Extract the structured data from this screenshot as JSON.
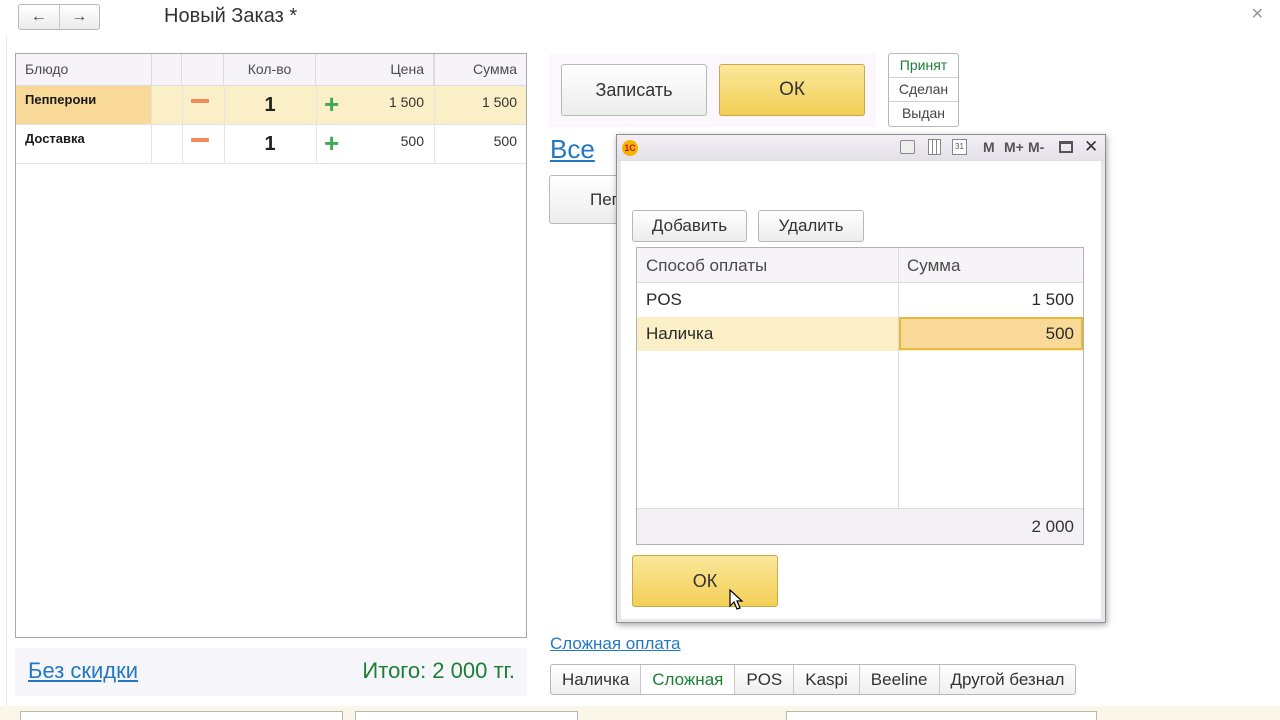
{
  "header": {
    "back_icon": "arrow-left-icon",
    "forward_icon": "arrow-right-icon",
    "title": "Новый Заказ *",
    "close_icon": "close-icon"
  },
  "order_table": {
    "columns": [
      "Блюдо",
      "Кол-во",
      "Цена",
      "Сумма"
    ],
    "rows": [
      {
        "dish": "Пепперони",
        "qty": "1",
        "price": "1 500",
        "sum": "1 500",
        "selected": true
      },
      {
        "dish": "Доставка",
        "qty": "1",
        "price": "500",
        "sum": "500",
        "selected": false
      }
    ]
  },
  "footer": {
    "discount_link": "Без скидки",
    "total": "Итого: 2 000 тг."
  },
  "actions": {
    "write_label": "Записать",
    "ok_label": "ОК"
  },
  "statuses": [
    {
      "label": "Принят",
      "active": true
    },
    {
      "label": "Сделан",
      "active": false
    },
    {
      "label": "Выдан",
      "active": false
    }
  ],
  "categories_link": "Все",
  "hidden_button_partial": "Пеп",
  "dialog": {
    "app_icon": "1c-logo-icon",
    "toolbar_icons": [
      "print-icon",
      "calculator-icon",
      "calendar-icon"
    ],
    "memory_buttons": [
      "M",
      "M+",
      "M-"
    ],
    "add_label": "Добавить",
    "delete_label": "Удалить",
    "columns": [
      "Способ оплаты",
      "Сумма"
    ],
    "rows": [
      {
        "method": "POS",
        "amount": "1 500"
      },
      {
        "method": "Наличка",
        "amount": "500"
      }
    ],
    "total": "2 000",
    "ok_label": "ОК"
  },
  "complex_payment_link": "Сложная оплата",
  "payment_tabs": [
    {
      "label": "Наличка",
      "active": false
    },
    {
      "label": "Сложная",
      "active": true
    },
    {
      "label": "POS",
      "active": false
    },
    {
      "label": "Kaspi",
      "active": false
    },
    {
      "label": "Beeline",
      "active": false
    },
    {
      "label": "Другой безнал",
      "active": false
    }
  ],
  "colors": {
    "selected_row": "#fbefc7",
    "selected_cell": "#f9d998",
    "primary_button": "#f2cf56",
    "link": "#2378c3",
    "total_green": "#1b7f35",
    "minus": "#f08a5a",
    "plus": "#3faa4f"
  }
}
